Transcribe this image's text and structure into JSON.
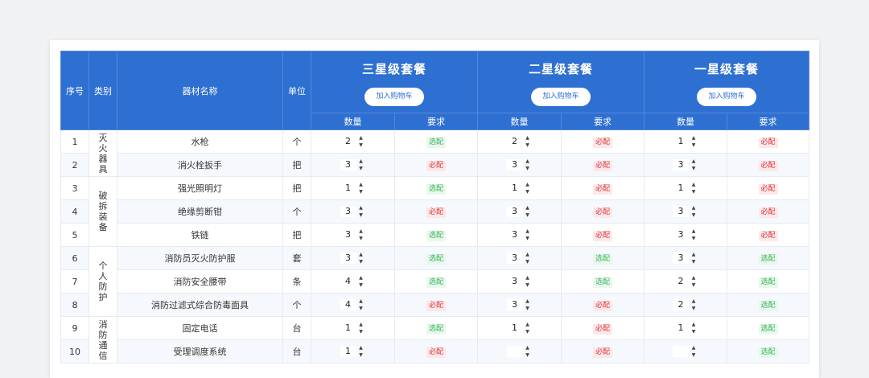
{
  "header": {
    "seq": "序号",
    "category": "类别",
    "name": "器材名称",
    "unit": "单位",
    "qty_label": "数量",
    "req_label": "要求",
    "cart_label": "加入购物车"
  },
  "packages": [
    {
      "title": "三星级套餐"
    },
    {
      "title": "二星级套餐"
    },
    {
      "title": "一星级套餐"
    }
  ],
  "categories": [
    {
      "label": "灭火器具"
    },
    {
      "label": "破拆装备"
    },
    {
      "label": "个人防护"
    },
    {
      "label": "消防通信"
    }
  ],
  "rows": [
    {
      "seq": "1",
      "name": "水枪",
      "unit": "个",
      "p": [
        {
          "qty": "2",
          "req": "选配"
        },
        {
          "qty": "2",
          "req": "必配"
        },
        {
          "qty": "1",
          "req": "必配"
        }
      ]
    },
    {
      "seq": "2",
      "name": "消火栓扳手",
      "unit": "把",
      "p": [
        {
          "qty": "3",
          "req": "必配"
        },
        {
          "qty": "3",
          "req": "必配"
        },
        {
          "qty": "3",
          "req": "必配"
        }
      ]
    },
    {
      "seq": "3",
      "name": "强光照明灯",
      "unit": "把",
      "p": [
        {
          "qty": "1",
          "req": "选配"
        },
        {
          "qty": "1",
          "req": "必配"
        },
        {
          "qty": "1",
          "req": "必配"
        }
      ]
    },
    {
      "seq": "4",
      "name": "绝缘剪断钳",
      "unit": "个",
      "p": [
        {
          "qty": "3",
          "req": "必配"
        },
        {
          "qty": "3",
          "req": "必配"
        },
        {
          "qty": "3",
          "req": "必配"
        }
      ]
    },
    {
      "seq": "5",
      "name": "铁链",
      "unit": "把",
      "p": [
        {
          "qty": "3",
          "req": "选配"
        },
        {
          "qty": "3",
          "req": "必配"
        },
        {
          "qty": "3",
          "req": "必配"
        }
      ]
    },
    {
      "seq": "6",
      "name": "消防员灭火防护服",
      "unit": "套",
      "p": [
        {
          "qty": "3",
          "req": "选配"
        },
        {
          "qty": "3",
          "req": "选配"
        },
        {
          "qty": "3",
          "req": "选配"
        }
      ]
    },
    {
      "seq": "7",
      "name": "消防安全腰带",
      "unit": "条",
      "p": [
        {
          "qty": "4",
          "req": "选配"
        },
        {
          "qty": "3",
          "req": "选配"
        },
        {
          "qty": "2",
          "req": "选配"
        }
      ]
    },
    {
      "seq": "8",
      "name": "消防过滤式综合防毒面具",
      "unit": "个",
      "p": [
        {
          "qty": "4",
          "req": "必配"
        },
        {
          "qty": "3",
          "req": "必配"
        },
        {
          "qty": "2",
          "req": "选配"
        }
      ]
    },
    {
      "seq": "9",
      "name": "固定电话",
      "unit": "台",
      "p": [
        {
          "qty": "1",
          "req": "选配"
        },
        {
          "qty": "1",
          "req": "必配"
        },
        {
          "qty": "1",
          "req": "选配"
        }
      ]
    },
    {
      "seq": "10",
      "name": "受理调度系统",
      "unit": "台",
      "p": [
        {
          "qty": "1",
          "req": "必配"
        },
        {
          "qty": "",
          "req": "必配"
        },
        {
          "qty": "",
          "req": "选配"
        }
      ]
    }
  ],
  "icons": {
    "step_up": "▲",
    "step_down": "▼"
  },
  "colors": {
    "header_bg": "#2e6fd2",
    "optional_text": "#3bb35d",
    "optional_bg": "#e8f8ec",
    "required_text": "#d9363e",
    "required_bg": "#fde8e8"
  }
}
